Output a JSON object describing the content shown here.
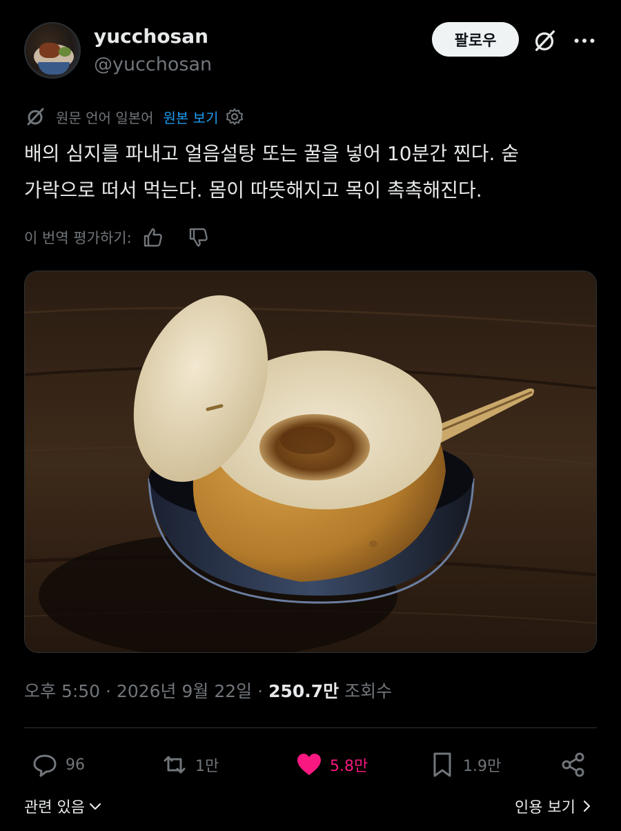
{
  "user": {
    "display_name": "yucchosan",
    "handle": "@yucchosan",
    "follow_label": "팔로우"
  },
  "translation": {
    "source_language_label": "원문 언어 일본어",
    "view_original_label": "원본 보기",
    "rate_label": "이 번역 평가하기:"
  },
  "post": {
    "line1": "배의 심지를 파내고 얼음설탕 또는 꿀을 넣어 10분간 찐다. 숟",
    "line2": "가락으로 떠서 먹는다. 몸이 따뜻해지고 목이 촉촉해진다."
  },
  "meta": {
    "timestamp": "오후 5:50 · 2026년 9월 22일 ·",
    "views_value": "250.7만",
    "views_label": "조회수"
  },
  "actions": {
    "replies": "96",
    "reposts": "1만",
    "likes": "5.8만",
    "bookmarks": "1.9만"
  },
  "footer": {
    "related_label": "관련 있음",
    "quotes_label": "인용 보기"
  },
  "colors": {
    "background": "#000000",
    "link": "#1d9bf0",
    "like": "#f91880",
    "muted": "#71767b"
  },
  "icons": [
    "grok-icon",
    "more-icon",
    "translate-icon",
    "gear-icon",
    "thumbs-up-icon",
    "thumbs-down-icon",
    "reply-icon",
    "repost-icon",
    "heart-icon",
    "bookmark-icon",
    "share-icon",
    "chevron-down-icon",
    "chevron-right-icon"
  ]
}
